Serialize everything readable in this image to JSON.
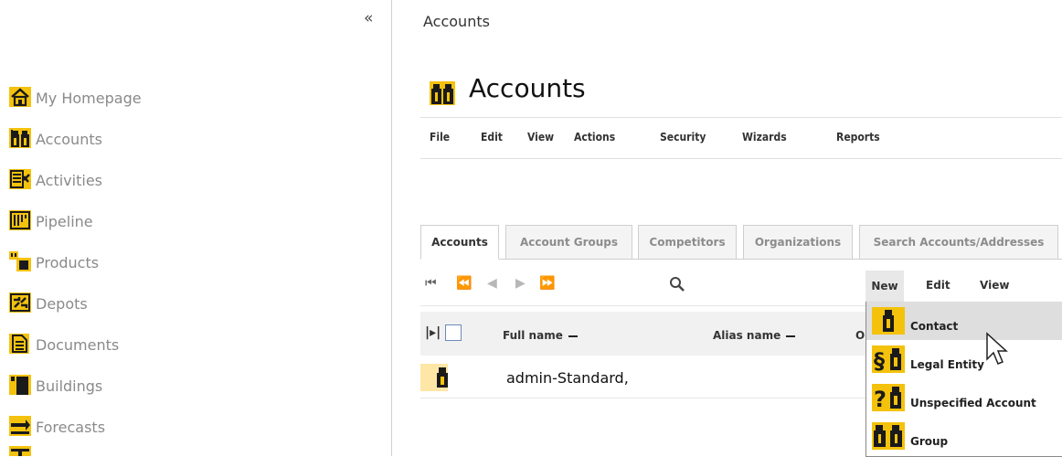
{
  "sidebar": {
    "collapse_label": "«",
    "items": [
      {
        "label": "My Homepage",
        "icon": "home-icon"
      },
      {
        "label": "Accounts",
        "icon": "accounts-icon"
      },
      {
        "label": "Activities",
        "icon": "activities-icon"
      },
      {
        "label": "Pipeline",
        "icon": "pipeline-icon"
      },
      {
        "label": "Products",
        "icon": "products-icon"
      },
      {
        "label": "Depots",
        "icon": "depots-icon"
      },
      {
        "label": "Documents",
        "icon": "documents-icon"
      },
      {
        "label": "Buildings",
        "icon": "buildings-icon"
      },
      {
        "label": "Forecasts",
        "icon": "forecasts-icon"
      }
    ]
  },
  "breadcrumb": "Accounts",
  "page": {
    "title": "Accounts"
  },
  "menubar": [
    "File",
    "Edit",
    "View",
    "Actions",
    "Security",
    "Wizards",
    "Reports"
  ],
  "tabs": [
    {
      "label": "Accounts",
      "active": true
    },
    {
      "label": "Account Groups",
      "active": false
    },
    {
      "label": "Competitors",
      "active": false
    },
    {
      "label": "Organizations",
      "active": false
    },
    {
      "label": "Search Accounts/Addresses",
      "active": false
    }
  ],
  "toolbar": {
    "new_label": "New",
    "edit_label": "Edit",
    "view_label": "View"
  },
  "table": {
    "columns": [
      "Full name",
      "Alias name",
      "O"
    ],
    "rows": [
      {
        "full_name": "admin-Standard,"
      }
    ]
  },
  "new_menu": [
    {
      "label": "Contact",
      "icon": "contact-icon"
    },
    {
      "label": "Legal Entity",
      "icon": "legal-entity-icon"
    },
    {
      "label": "Unspecified Account",
      "icon": "unspecified-account-icon"
    },
    {
      "label": "Group",
      "icon": "group-icon"
    }
  ],
  "colors": {
    "accent_yellow": "#f4c20d",
    "icon_dark": "#1a1a1a",
    "hover_gray": "#dedede"
  }
}
